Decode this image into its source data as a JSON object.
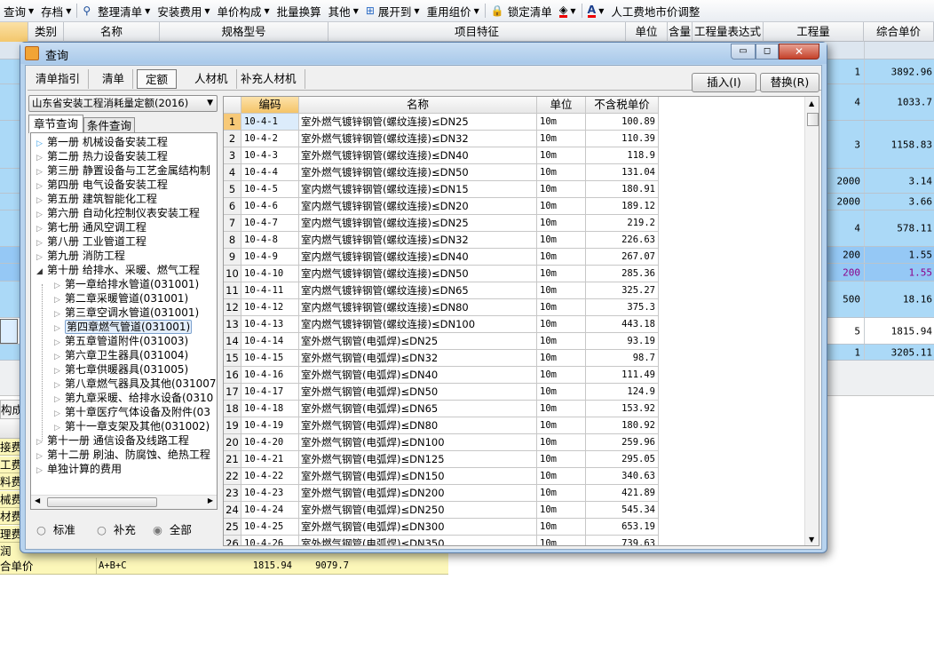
{
  "toolbar": {
    "items": [
      "查询",
      "存档",
      "整理清单",
      "安装费用",
      "单价构成",
      "批量换算",
      "其他",
      "展开到",
      "重用组价",
      "锁定清单",
      "人工费地市价调整"
    ]
  },
  "bg_header": [
    "类别",
    "名称",
    "规格型号",
    "项目特征",
    "单位",
    "含量",
    "工程量表达式",
    "工程量",
    "综合单价"
  ],
  "bg_rows": [
    {
      "qty": "1",
      "price": "3892.96"
    },
    {
      "qty": "4",
      "price": "1033.7"
    },
    {
      "qty": "3",
      "price": "1158.83"
    },
    {
      "qty": "2000",
      "price": "3.14"
    },
    {
      "qty": "2000",
      "price": "3.66"
    },
    {
      "qty": "4",
      "price": "578.11"
    },
    {
      "qty": "200",
      "price": "1.55"
    },
    {
      "qty": "200",
      "price": "1.55"
    },
    {
      "qty": "500",
      "price": "18.16"
    },
    {
      "qty": "5",
      "price": "1815.94"
    },
    {
      "qty": "1",
      "price": "3205.11"
    }
  ],
  "bottom": {
    "tab": "构成",
    "labels": [
      "接费",
      "工费",
      "料费",
      "械费",
      "材费",
      "理费",
      "润"
    ],
    "total": {
      "label": "合单价",
      "formula": "A+B+C",
      "value1": "1815.94",
      "value2": "9079.7"
    }
  },
  "dialog": {
    "title": "查询",
    "tabs": [
      "清单指引",
      "清单",
      "定额",
      "人材机",
      "补充人材机"
    ],
    "active_tab": "定额",
    "insert_button": "插入(I)",
    "replace_button": "替换(R)",
    "library": "山东省安装工程消耗量定额(2016)",
    "subtabs": [
      "章节查询",
      "条件查询"
    ],
    "tree": [
      {
        "label": "第一册  机械设备安装工程",
        "level": 0
      },
      {
        "label": "第二册  热力设备安装工程",
        "level": 0
      },
      {
        "label": "第三册  静置设备与工艺金属结构制",
        "level": 0
      },
      {
        "label": "第四册  电气设备安装工程",
        "level": 0
      },
      {
        "label": "第五册  建筑智能化工程",
        "level": 0
      },
      {
        "label": "第六册  自动化控制仪表安装工程",
        "level": 0
      },
      {
        "label": "第七册  通风空调工程",
        "level": 0
      },
      {
        "label": "第八册  工业管道工程",
        "level": 0
      },
      {
        "label": "第九册  消防工程",
        "level": 0
      },
      {
        "label": "第十册  给排水、采暖、燃气工程",
        "level": 0,
        "expanded": true
      },
      {
        "label": "第一章给排水管道(031001)",
        "level": 1
      },
      {
        "label": "第二章采暖管道(031001)",
        "level": 1
      },
      {
        "label": "第三章空调水管道(031001)",
        "level": 1
      },
      {
        "label": "第四章燃气管道(031001)",
        "level": 1,
        "selected": true
      },
      {
        "label": "第五章管道附件(031003)",
        "level": 1
      },
      {
        "label": "第六章卫生器具(031004)",
        "level": 1
      },
      {
        "label": "第七章供暖器具(031005)",
        "level": 1
      },
      {
        "label": "第八章燃气器具及其他(031007",
        "level": 1
      },
      {
        "label": "第九章采暖、给排水设备(0310",
        "level": 1
      },
      {
        "label": "第十章医疗气体设备及附件(03",
        "level": 1
      },
      {
        "label": "第十一章支架及其他(031002)",
        "level": 1
      },
      {
        "label": "第十一册  通信设备及线路工程",
        "level": 0
      },
      {
        "label": "第十二册  刷油、防腐蚀、绝热工程",
        "level": 0
      },
      {
        "label": "单独计算的费用",
        "level": 0
      }
    ],
    "radios": [
      {
        "label": "标准",
        "checked": false
      },
      {
        "label": "补充",
        "checked": false
      },
      {
        "label": "全部",
        "checked": true
      }
    ],
    "columns": [
      "编码",
      "名称",
      "单位",
      "不含税单价"
    ],
    "rows": [
      [
        "1",
        "10-4-1",
        "室外燃气镀锌钢管(螺纹连接)≤DN25",
        "10m",
        "100.89"
      ],
      [
        "2",
        "10-4-2",
        "室外燃气镀锌钢管(螺纹连接)≤DN32",
        "10m",
        "110.39"
      ],
      [
        "3",
        "10-4-3",
        "室外燃气镀锌钢管(螺纹连接)≤DN40",
        "10m",
        "118.9"
      ],
      [
        "4",
        "10-4-4",
        "室外燃气镀锌钢管(螺纹连接)≤DN50",
        "10m",
        "131.04"
      ],
      [
        "5",
        "10-4-5",
        "室内燃气镀锌钢管(螺纹连接)≤DN15",
        "10m",
        "180.91"
      ],
      [
        "6",
        "10-4-6",
        "室内燃气镀锌钢管(螺纹连接)≤DN20",
        "10m",
        "189.12"
      ],
      [
        "7",
        "10-4-7",
        "室内燃气镀锌钢管(螺纹连接)≤DN25",
        "10m",
        "219.2"
      ],
      [
        "8",
        "10-4-8",
        "室内燃气镀锌钢管(螺纹连接)≤DN32",
        "10m",
        "226.63"
      ],
      [
        "9",
        "10-4-9",
        "室内燃气镀锌钢管(螺纹连接)≤DN40",
        "10m",
        "267.07"
      ],
      [
        "10",
        "10-4-10",
        "室内燃气镀锌钢管(螺纹连接)≤DN50",
        "10m",
        "285.36"
      ],
      [
        "11",
        "10-4-11",
        "室内燃气镀锌钢管(螺纹连接)≤DN65",
        "10m",
        "325.27"
      ],
      [
        "12",
        "10-4-12",
        "室内燃气镀锌钢管(螺纹连接)≤DN80",
        "10m",
        "375.3"
      ],
      [
        "13",
        "10-4-13",
        "室内燃气镀锌钢管(螺纹连接)≤DN100",
        "10m",
        "443.18"
      ],
      [
        "14",
        "10-4-14",
        "室外燃气钢管(电弧焊)≤DN25",
        "10m",
        "93.19"
      ],
      [
        "15",
        "10-4-15",
        "室外燃气钢管(电弧焊)≤DN32",
        "10m",
        "98.7"
      ],
      [
        "16",
        "10-4-16",
        "室外燃气钢管(电弧焊)≤DN40",
        "10m",
        "111.49"
      ],
      [
        "17",
        "10-4-17",
        "室外燃气钢管(电弧焊)≤DN50",
        "10m",
        "124.9"
      ],
      [
        "18",
        "10-4-18",
        "室外燃气钢管(电弧焊)≤DN65",
        "10m",
        "153.92"
      ],
      [
        "19",
        "10-4-19",
        "室外燃气钢管(电弧焊)≤DN80",
        "10m",
        "180.92"
      ],
      [
        "20",
        "10-4-20",
        "室外燃气钢管(电弧焊)≤DN100",
        "10m",
        "259.96"
      ],
      [
        "21",
        "10-4-21",
        "室外燃气钢管(电弧焊)≤DN125",
        "10m",
        "295.05"
      ],
      [
        "22",
        "10-4-22",
        "室外燃气钢管(电弧焊)≤DN150",
        "10m",
        "340.63"
      ],
      [
        "23",
        "10-4-23",
        "室外燃气钢管(电弧焊)≤DN200",
        "10m",
        "421.89"
      ],
      [
        "24",
        "10-4-24",
        "室外燃气钢管(电弧焊)≤DN250",
        "10m",
        "545.34"
      ],
      [
        "25",
        "10-4-25",
        "室外燃气钢管(电弧焊)≤DN300",
        "10m",
        "653.19"
      ],
      [
        "26",
        "10-4-26",
        "室外燃气钢管(电弧焊)≤DN350",
        "10m",
        "739.63"
      ]
    ]
  },
  "colors": {
    "row_blue": "#abd9f7",
    "row_selected": "#95c8f5",
    "header_orange": "#f7c978",
    "purple_text": "#8b008b",
    "yellow": "#fcf7b9"
  }
}
